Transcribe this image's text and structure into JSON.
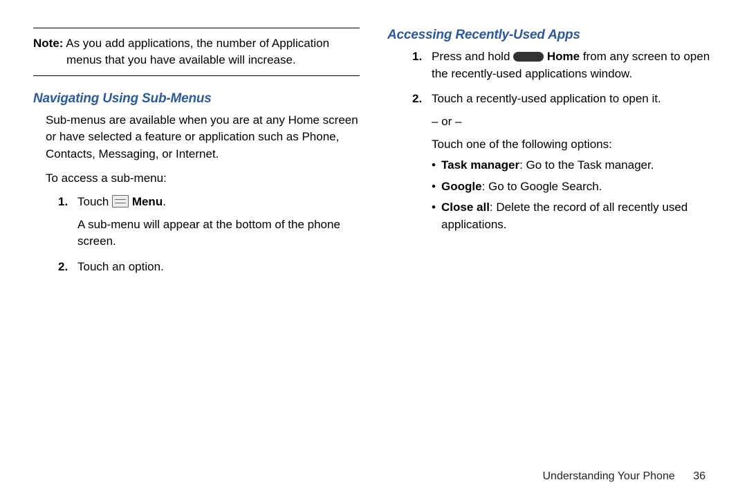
{
  "left": {
    "note_label": "Note:",
    "note_text_1": " As you add applications, the number of Application",
    "note_text_2": "menus that you have available will increase.",
    "heading": "Navigating Using Sub-Menus",
    "intro": "Sub-menus are available when you are at any Home screen or have selected a feature or application such as Phone, Contacts, Messaging, or Internet.",
    "access_line": "To access a sub-menu:",
    "steps": [
      {
        "num": "1.",
        "pre": "Touch ",
        "icon": "menu",
        "bold": " Menu",
        "post": ".",
        "sub": "A sub-menu will appear at the bottom of the phone screen."
      },
      {
        "num": "2.",
        "pre": "Touch an option.",
        "icon": "",
        "bold": "",
        "post": "",
        "sub": ""
      }
    ]
  },
  "right": {
    "heading": "Accessing Recently-Used Apps",
    "steps": [
      {
        "num": "1.",
        "pre": "Press and hold ",
        "icon": "home",
        "bold": " Home",
        "post": " from any screen to open the recently-used applications window."
      },
      {
        "num": "2.",
        "pre": "Touch a recently-used application to open it.",
        "or": "– or –",
        "follow": "Touch one of the following options:",
        "bullets": [
          {
            "b": "Task manager",
            "t": ": Go to the Task manager."
          },
          {
            "b": "Google",
            "t": ": Go to Google Search."
          },
          {
            "b": "Close all",
            "t": ": Delete the record of all recently used applications."
          }
        ]
      }
    ]
  },
  "footer": {
    "section": "Understanding Your Phone",
    "page": "36"
  }
}
